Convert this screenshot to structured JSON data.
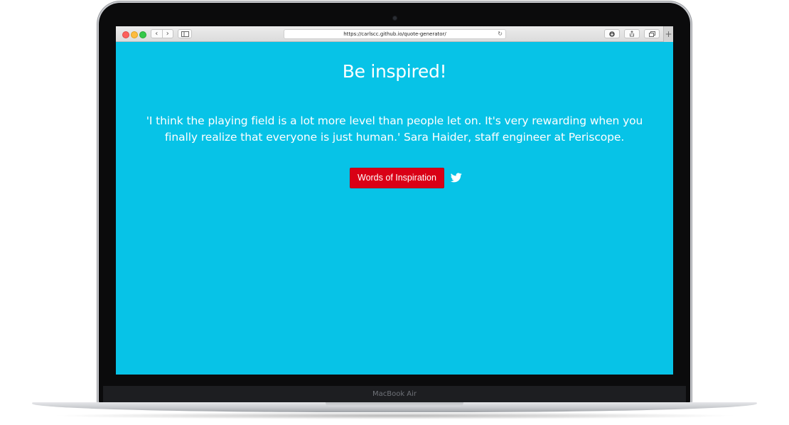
{
  "device": {
    "brand": "MacBook Air"
  },
  "browser": {
    "url": "https://carlscc.github.io/quote-generator/",
    "back_icon": "chevron-left-icon",
    "forward_icon": "chevron-right-icon",
    "sidebar_icon": "sidebar-icon",
    "reload_icon": "reload-icon",
    "download_icon": "download-icon",
    "share_icon": "share-icon",
    "tabs_icon": "tabs-icon",
    "new_tab_icon": "plus-icon"
  },
  "page": {
    "title": "Be inspired!",
    "quote": "'I think the playing field is a lot more level than people let on. It's very rewarding when you finally realize that everyone is just human.' Sara Haider, staff engineer at Periscope.",
    "button_label": "Words of Inspiration",
    "share_icon": "twitter-icon",
    "colors": {
      "background": "#07c3e7",
      "button": "#d90016",
      "text": "#ffffff"
    }
  }
}
